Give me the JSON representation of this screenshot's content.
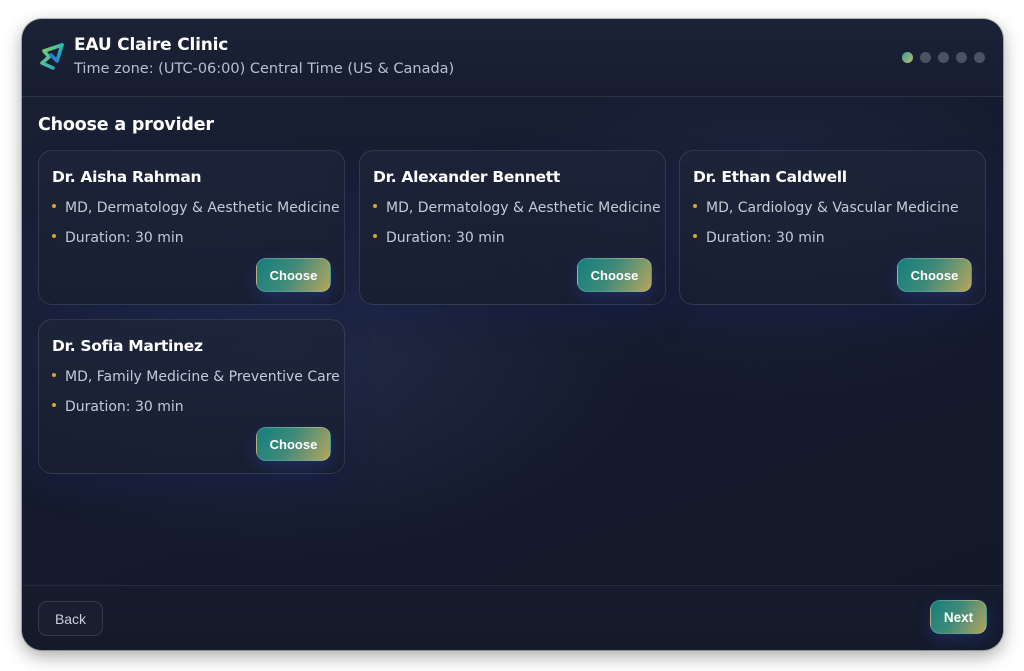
{
  "header": {
    "clinic_name": "EAU Claire Clinic",
    "timezone": "Time zone: (UTC-06:00) Central Time (US & Canada)",
    "logo_icon": "clinic-logo-icon",
    "steps": {
      "total": 5,
      "current": 1
    }
  },
  "main": {
    "section_title": "Choose a provider",
    "providers": [
      {
        "name": "Dr. Aisha Rahman",
        "specialty": "MD, Dermatology & Aesthetic Medicine",
        "duration": "Duration: 30 min",
        "button_label": "Choose"
      },
      {
        "name": "Dr. Alexander Bennett",
        "specialty": "MD, Dermatology & Aesthetic Medicine",
        "duration": "Duration: 30 min",
        "button_label": "Choose"
      },
      {
        "name": "Dr. Ethan Caldwell",
        "specialty": "MD, Cardiology & Vascular Medicine",
        "duration": "Duration: 30 min",
        "button_label": "Choose"
      },
      {
        "name": "Dr. Sofia Martinez",
        "specialty": "MD, Family Medicine & Preventive Care",
        "duration": "Duration: 30 min",
        "button_label": "Choose"
      }
    ]
  },
  "footer": {
    "back_label": "Back",
    "next_label": "Next"
  },
  "colors": {
    "background": "#161c2e",
    "accent_start": "#147f7d",
    "accent_end": "#b7a55c",
    "bullet": "#d8a23c",
    "text_primary": "#ffffff",
    "text_secondary": "#c5cad6"
  }
}
